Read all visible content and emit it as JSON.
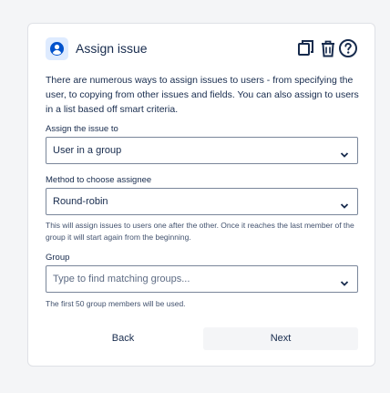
{
  "header": {
    "title": "Assign issue",
    "app_icon": "user-circle-icon",
    "actions": [
      "copy-icon",
      "trash-icon",
      "help-icon"
    ]
  },
  "description": "There are numerous ways to assign issues to users - from specifying the user, to copying from other issues and fields. You can also assign to users in a list based off smart criteria.",
  "assign_to": {
    "label": "Assign the issue to",
    "value": "User in a group"
  },
  "method": {
    "label": "Method to choose assignee",
    "value": "Round-robin",
    "hint": "This will assign issues to users one after the other. Once it reaches the last member of the group it will start again from the beginning."
  },
  "group": {
    "label": "Group",
    "placeholder": "Type to find matching groups...",
    "hint": "The first 50 group members will be used."
  },
  "buttons": {
    "back": "Back",
    "next": "Next"
  },
  "colors": {
    "accent": "#0052cc",
    "icon_bg": "#deebff",
    "border": "#7a869a"
  }
}
